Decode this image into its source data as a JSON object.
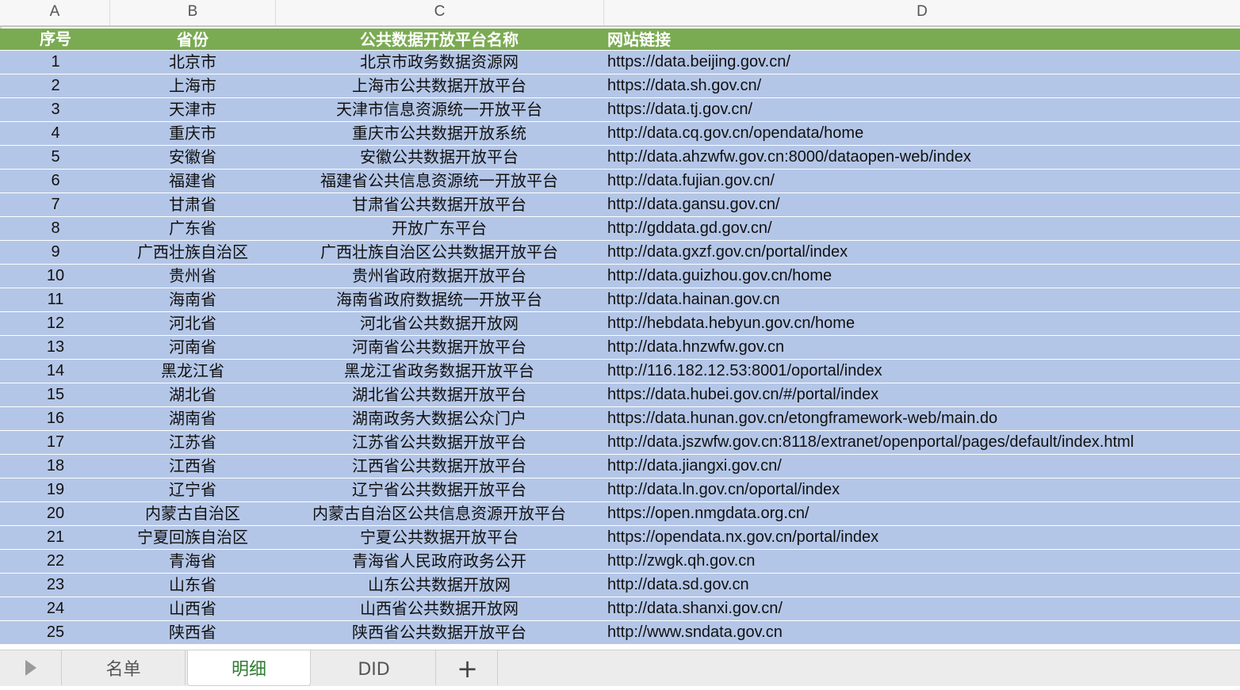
{
  "column_headers": [
    "A",
    "B",
    "C",
    "D"
  ],
  "table": {
    "header": [
      "序号",
      "省份",
      "公共数据开放平台名称",
      "网站链接"
    ],
    "rows": [
      [
        "1",
        "北京市",
        "北京市政务数据资源网",
        "https://data.beijing.gov.cn/"
      ],
      [
        "2",
        "上海市",
        "上海市公共数据开放平台",
        "https://data.sh.gov.cn/"
      ],
      [
        "3",
        "天津市",
        "天津市信息资源统一开放平台",
        "https://data.tj.gov.cn/"
      ],
      [
        "4",
        "重庆市",
        "重庆市公共数据开放系统",
        "http://data.cq.gov.cn/opendata/home"
      ],
      [
        "5",
        "安徽省",
        "安徽公共数据开放平台",
        "http://data.ahzwfw.gov.cn:8000/dataopen-web/index"
      ],
      [
        "6",
        "福建省",
        "福建省公共信息资源统一开放平台",
        "http://data.fujian.gov.cn/"
      ],
      [
        "7",
        "甘肃省",
        "甘肃省公共数据开放平台",
        "http://data.gansu.gov.cn/"
      ],
      [
        "8",
        "广东省",
        "开放广东平台",
        "http://gddata.gd.gov.cn/"
      ],
      [
        "9",
        "广西壮族自治区",
        "广西壮族自治区公共数据开放平台",
        "http://data.gxzf.gov.cn/portal/index"
      ],
      [
        "10",
        "贵州省",
        "贵州省政府数据开放平台",
        "http://data.guizhou.gov.cn/home"
      ],
      [
        "11",
        "海南省",
        "海南省政府数据统一开放平台",
        "http://data.hainan.gov.cn"
      ],
      [
        "12",
        "河北省",
        "河北省公共数据开放网",
        "http://hebdata.hebyun.gov.cn/home"
      ],
      [
        "13",
        "河南省",
        "河南省公共数据开放平台",
        "http://data.hnzwfw.gov.cn"
      ],
      [
        "14",
        "黑龙江省",
        "黑龙江省政务数据开放平台",
        "http://116.182.12.53:8001/oportal/index"
      ],
      [
        "15",
        "湖北省",
        "湖北省公共数据开放平台",
        "https://data.hubei.gov.cn/#/portal/index"
      ],
      [
        "16",
        "湖南省",
        "湖南政务大数据公众门户",
        "https://data.hunan.gov.cn/etongframework-web/main.do"
      ],
      [
        "17",
        "江苏省",
        "江苏省公共数据开放平台",
        "http://data.jszwfw.gov.cn:8118/extranet/openportal/pages/default/index.html"
      ],
      [
        "18",
        "江西省",
        "江西省公共数据开放平台",
        "http://data.jiangxi.gov.cn/"
      ],
      [
        "19",
        "辽宁省",
        "辽宁省公共数据开放平台",
        "http://data.ln.gov.cn/oportal/index"
      ],
      [
        "20",
        "内蒙古自治区",
        "内蒙古自治区公共信息资源开放平台",
        "https://open.nmgdata.org.cn/"
      ],
      [
        "21",
        "宁夏回族自治区",
        "宁夏公共数据开放平台",
        "https://opendata.nx.gov.cn/portal/index"
      ],
      [
        "22",
        "青海省",
        "青海省人民政府政务公开",
        "http://zwgk.qh.gov.cn"
      ],
      [
        "23",
        "山东省",
        "山东公共数据开放网",
        "http://data.sd.gov.cn"
      ],
      [
        "24",
        "山西省",
        "山西省公共数据开放网",
        "http://data.shanxi.gov.cn/"
      ],
      [
        "25",
        "陕西省",
        "陕西省公共数据开放平台",
        "http://www.sndata.gov.cn"
      ]
    ]
  },
  "sheet_tabs": [
    {
      "label": "名单",
      "active": false
    },
    {
      "label": "明细",
      "active": true
    },
    {
      "label": "DID",
      "active": false
    }
  ],
  "add_sheet_label": "+",
  "colors": {
    "header_fill": "#7aab52",
    "band_fill": "#b4c6e7",
    "active_tab_text": "#2e7d32"
  }
}
